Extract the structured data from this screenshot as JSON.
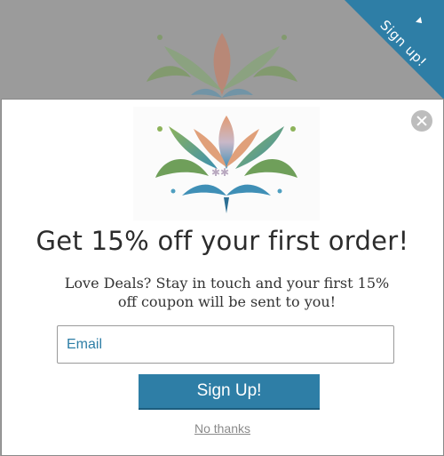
{
  "background": {
    "logo_icon": "floral-ornament-logo"
  },
  "corner_tab": {
    "label": "Sign up!",
    "color": "#2e7ea6"
  },
  "modal": {
    "logo_icon": "floral-ornament-logo",
    "close_icon": "close-icon",
    "headline": "Get 15% off your first order!",
    "subtext": "Love Deals? Stay in touch and your first 15% off coupon will be sent to you!",
    "email_placeholder": "Email",
    "email_value": "",
    "signup_label": "Sign Up!",
    "no_thanks_label": "No thanks",
    "accent_color": "#2e7ea6"
  }
}
